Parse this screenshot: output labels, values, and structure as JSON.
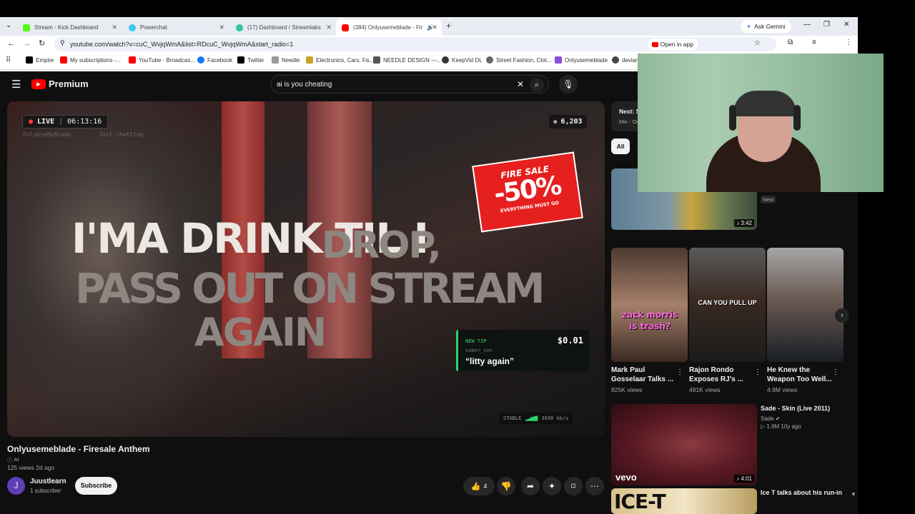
{
  "tabs": [
    {
      "title": "Stream - Kick Dashboard",
      "color": "#53fc18"
    },
    {
      "title": "Powerchat",
      "color": "#3bc8e8"
    },
    {
      "title": "(17) Dashboard / Streamlabs",
      "color": "#31c3a2"
    },
    {
      "title": "(384) Onlyusemeblade - Fir",
      "color": "#ff0000"
    }
  ],
  "browser": {
    "url": "youtube.com/watch?v=cuC_WvjqWmA&list=RDcuC_WvjqWmA&start_radio=1",
    "ask_gemini": "Ask Gemini",
    "open_in_app": "Open in app"
  },
  "bookmarks": [
    "Empire",
    "My subscriptions -...",
    "YouTube - Broadcas...",
    "Facebook",
    "Twitter",
    "Needle",
    "Electronics, Cars, Fa...",
    "NEEDLE DESIGN —...",
    "KeepVid DL",
    "Street Fashion, Clot...",
    "Onlyusemeblade",
    "devian"
  ],
  "youtube": {
    "logo": "Premium",
    "search_query": "ai is you cheating"
  },
  "player": {
    "live_label": "LIVE",
    "timer": "06:13:16",
    "channel_overlay": "OnlyUseMeBlade",
    "category_overlay": "Just chatting",
    "viewers": "6,203",
    "lyric_line1a": "I'MA DRINK TIL I",
    "lyric_line1b": "DROP,",
    "lyric_line2": "PASS OUT ON STREAM",
    "lyric_line3": "AGAIN",
    "sale_top": "FIRE SALE",
    "sale_big": "-50%",
    "sale_bottom": "EVERYTHING MUST GO",
    "tip_label": "NEW TIP",
    "tip_amount": "$0.01",
    "tip_user": "sober_son",
    "tip_message": "“litty again”",
    "stable_label": "STABLE",
    "bitrate": "3038 kb/s"
  },
  "video": {
    "title": "Onlyusemeblade - Firesale Anthem",
    "ai_badge": "AI",
    "views_date": "125 views  2d ago",
    "channel": "Juustlearn",
    "channel_initial": "J",
    "subscribers": "1 subscriber",
    "subscribe_label": "Subscribe",
    "like_count": "4"
  },
  "sidebar": {
    "next_label": "Next: S",
    "mix_label": "Mix - Or",
    "chip_all": "All",
    "first_new_badge": "New",
    "first_duration": "3:42",
    "shorts": [
      {
        "caption": "zack morris is trash?",
        "title": "Mark Paul Gosselaar Talks ...",
        "views": "825K views"
      },
      {
        "caption": "CAN YOU PULL UP",
        "title": "Rajon Rondo Exposes RJ's ...",
        "views": "491K views"
      },
      {
        "caption": "",
        "title": "He Knew the Weapon Too Well...",
        "views": "4.9M views"
      }
    ],
    "video2": {
      "title": "Sade - Skin (Live 2011)",
      "channel": "Sade",
      "meta": "1.6M  10y ago",
      "duration": "4:01",
      "brand": "vevo"
    },
    "video3": {
      "title": "Ice T talks about his run-in",
      "brand": "ICE-T"
    }
  },
  "colors": {
    "yt_red": "#ff0000",
    "tip_green": "#2bd66b",
    "sale_red": "#e5201f"
  }
}
